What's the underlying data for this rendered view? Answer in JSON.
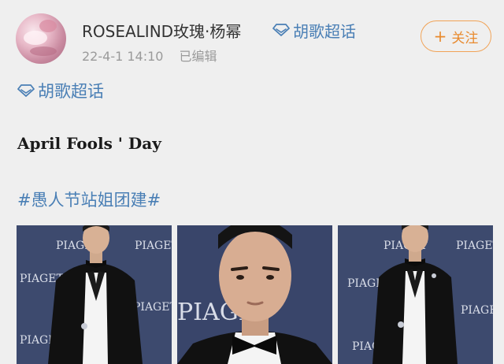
{
  "user": {
    "name": "ROSEALIND玫瑰·杨幂",
    "super_topic": "胡歌超话",
    "timestamp": "22-4-1 14:10",
    "edited_label": "已编辑",
    "follow_label": "关注"
  },
  "post": {
    "topic": "胡歌超话",
    "title": "April Fools ' Day",
    "hashtag": "#愚人节站姐团建#"
  },
  "photos": [
    {
      "backdrop_text": "PIAGET"
    },
    {
      "backdrop_text": "PIAGET"
    },
    {
      "backdrop_text": "PIAGET"
    }
  ],
  "colors": {
    "link_blue": "#4a7fb5",
    "follow_orange": "#e88a2e",
    "background": "#efefef",
    "backdrop_navy": "#3b4668"
  },
  "icons": {
    "super_topic": "diamond-icon",
    "follow": "plus-icon"
  }
}
